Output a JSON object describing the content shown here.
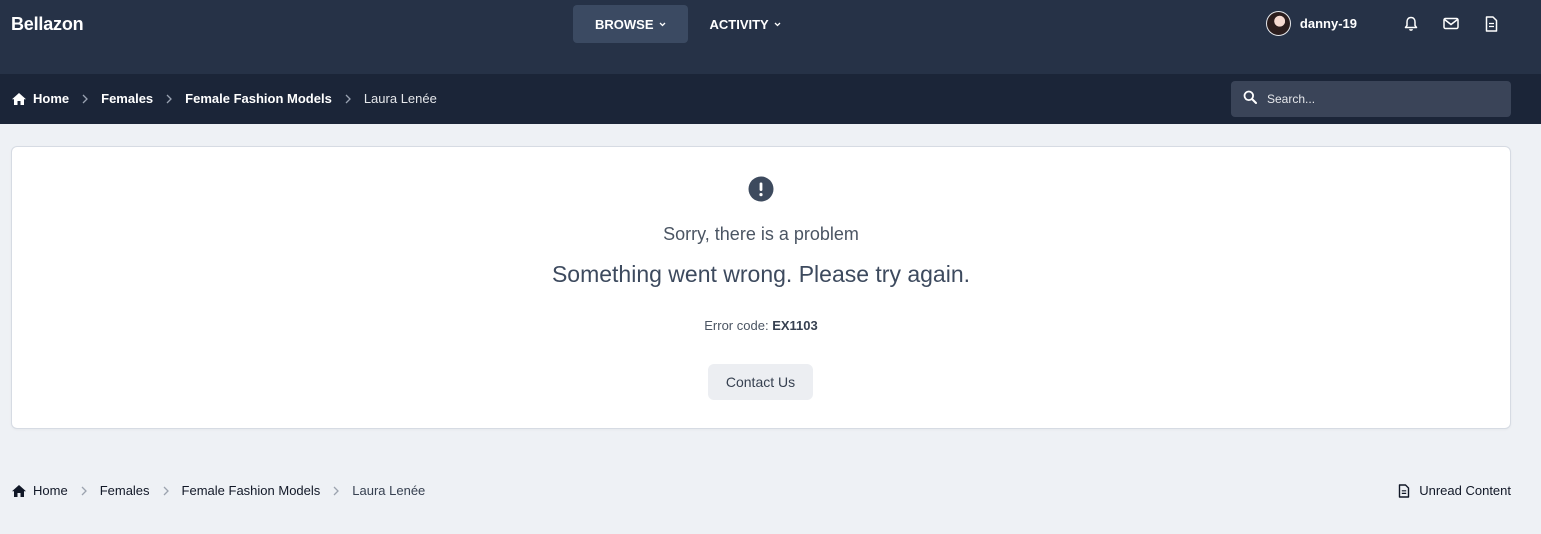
{
  "header": {
    "brand": "Bellazon",
    "nav": [
      {
        "label": "BROWSE",
        "active": true
      },
      {
        "label": "ACTIVITY",
        "active": false
      }
    ],
    "user": {
      "name": "danny-19"
    },
    "icons": [
      "bell-icon",
      "envelope-icon",
      "document-icon"
    ]
  },
  "breadcrumb": [
    {
      "label": "Home",
      "icon": "home-icon"
    },
    {
      "label": "Females"
    },
    {
      "label": "Female Fashion Models"
    },
    {
      "label": "Laura Lenée"
    }
  ],
  "search": {
    "placeholder": "Search..."
  },
  "error": {
    "icon": "exclamation-icon",
    "title": "Sorry, there is a problem",
    "message": "Something went wrong. Please try again.",
    "code_label": "Error code:",
    "code": "EX1103",
    "button": "Contact Us"
  },
  "footer": {
    "unread_label": "Unread Content",
    "unread_icon": "document-icon"
  },
  "colors": {
    "topbar": "#263247",
    "breadcrumb_bar": "#1b2538",
    "page_bg": "#eef1f5",
    "active_tab": "#3b4a62",
    "search_bg": "#3a4458"
  }
}
